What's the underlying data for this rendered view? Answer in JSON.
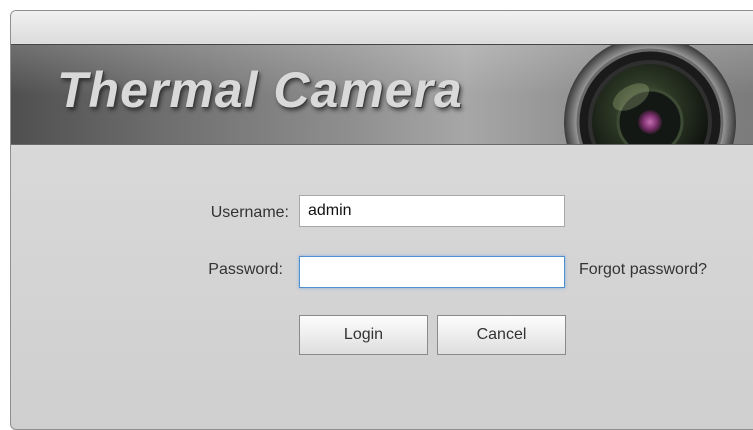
{
  "banner": {
    "title": "Thermal Camera",
    "logo_icon": "camera-lens-icon"
  },
  "login_form": {
    "username_label": "Username:",
    "username_value": "admin",
    "password_label": "Password:",
    "password_value": "",
    "forgot_password_link": "Forgot password?",
    "login_button": "Login",
    "cancel_button": "Cancel"
  },
  "colors": {
    "banner_dark": "#4f4f4f",
    "panel_bg": "#d8d8d8",
    "focus_border": "#4f90d0",
    "lens_iris": "#8a3f7a"
  }
}
